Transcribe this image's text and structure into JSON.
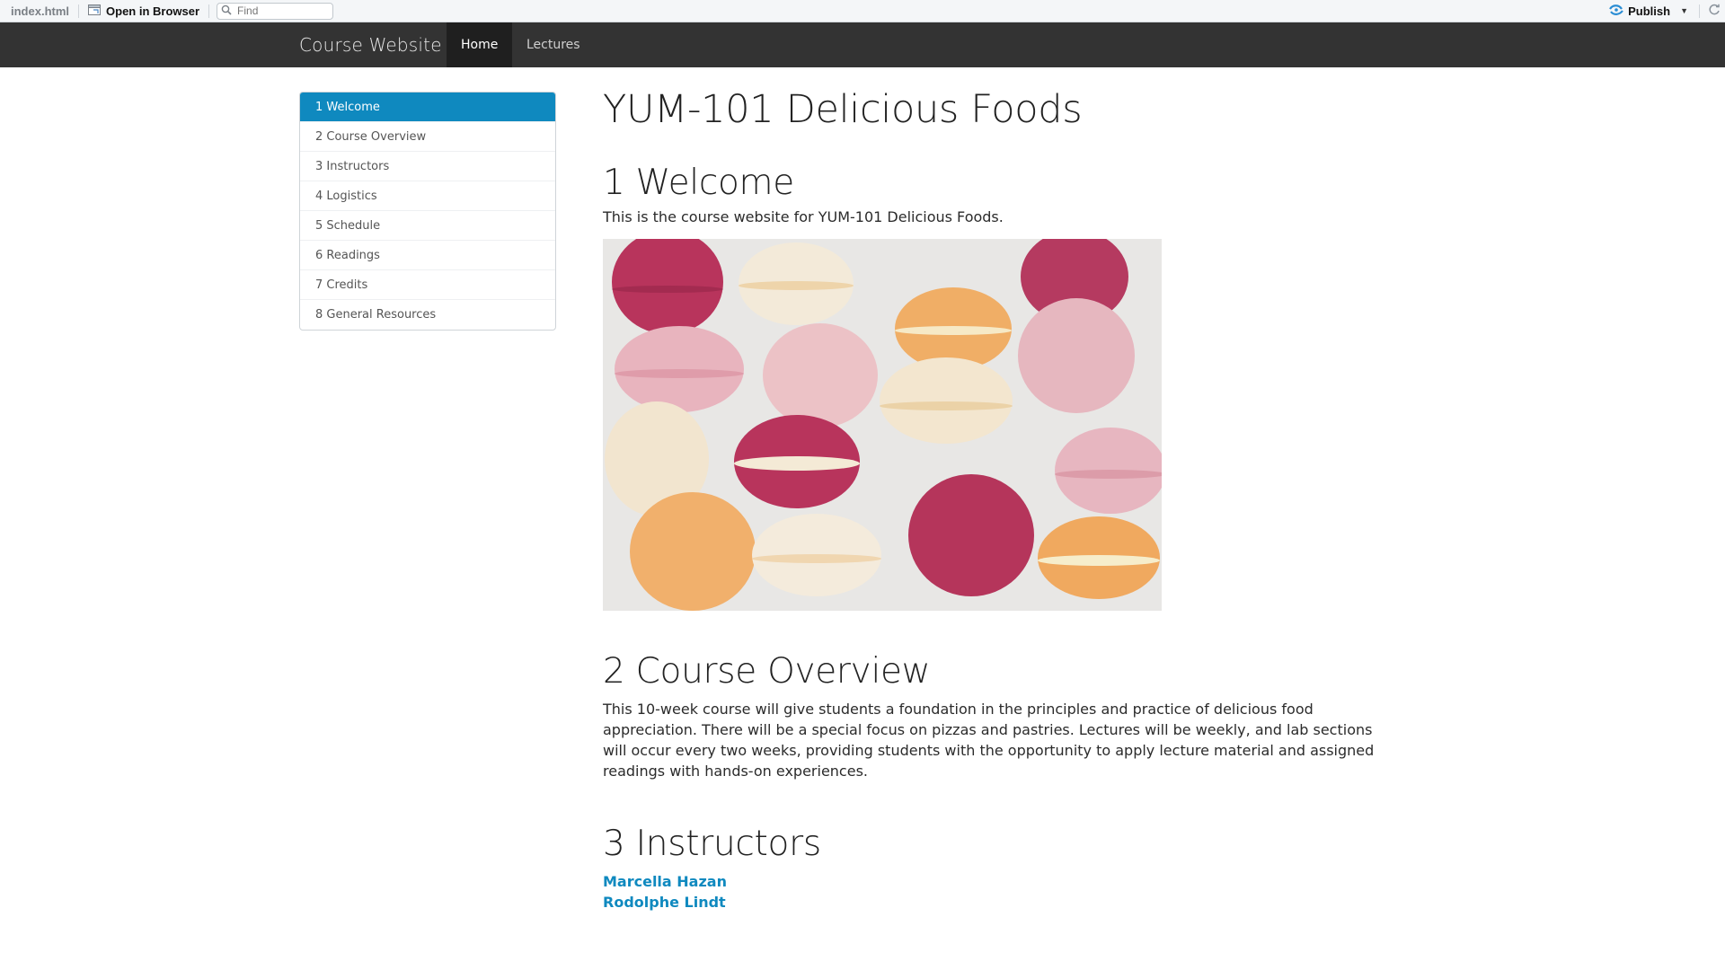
{
  "viewer": {
    "filename": "index.html",
    "open_in_browser_label": "Open in Browser",
    "find_placeholder": "Find",
    "publish_label": "Publish"
  },
  "navbar": {
    "brand": "Course Website",
    "items": [
      {
        "label": "Home",
        "active": true
      },
      {
        "label": "Lectures",
        "active": false
      }
    ]
  },
  "toc": {
    "items": [
      {
        "label": "1 Welcome",
        "active": true
      },
      {
        "label": "2 Course Overview"
      },
      {
        "label": "3 Instructors"
      },
      {
        "label": "4 Logistics"
      },
      {
        "label": "5 Schedule"
      },
      {
        "label": "6 Readings"
      },
      {
        "label": "7 Credits"
      },
      {
        "label": "8 General Resources"
      }
    ]
  },
  "main": {
    "title": "YUM-101 Delicious Foods",
    "welcome": {
      "heading": "1 Welcome",
      "text": "This is the course website for YUM-101 Delicious Foods."
    },
    "overview": {
      "heading": "2 Course Overview",
      "text": "This 10-week course will give students a foundation in the principles and practice of delicious food appreciation. There will be a special focus on pizzas and pastries. Lectures will be weekly, and lab sections will occur every two weeks, providing students with the opportunity to apply lecture material and assigned readings with hands-on experiences."
    },
    "instructors": {
      "heading": "3 Instructors",
      "people": [
        "Marcella Hazan",
        "Rodolphe Lindt"
      ]
    }
  },
  "colors": {
    "navbar_bg": "#333333",
    "accent_blue": "#0f89bf",
    "macaron_pink": "#b8345c",
    "macaron_orange": "#f0b06a",
    "macaron_cream": "#f3ead9",
    "macaron_light_pink": "#e9bcc4"
  }
}
